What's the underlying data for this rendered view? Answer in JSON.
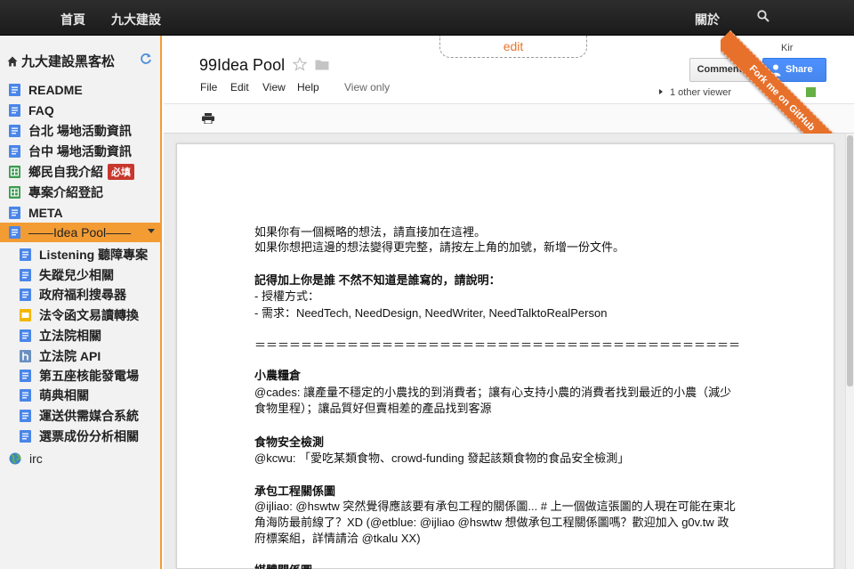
{
  "topnav": {
    "links": [
      "首頁",
      "九大建設"
    ],
    "about": "關於"
  },
  "github_ribbon": "Fork me on GitHub",
  "sidebar": {
    "title": "九大建設黑客松",
    "items": [
      {
        "label": "README",
        "icon": "doc-icon"
      },
      {
        "label": "FAQ",
        "icon": "doc-icon"
      },
      {
        "label": "台北 場地活動資訊",
        "icon": "doc-icon"
      },
      {
        "label": "台中 場地活動資訊",
        "icon": "doc-icon"
      },
      {
        "label": "鄉民自我介紹",
        "icon": "spreadsheet-icon",
        "badge": "必填"
      },
      {
        "label": "專案介紹登記",
        "icon": "spreadsheet-icon"
      },
      {
        "label": "META",
        "icon": "doc-icon"
      },
      {
        "label": "——Idea Pool——",
        "icon": "doc-icon",
        "active": true
      },
      {
        "label": "Listening 聽障專案",
        "icon": "doc-icon"
      },
      {
        "label": "失蹤兒少相關",
        "icon": "doc-icon"
      },
      {
        "label": "政府福利搜尋器",
        "icon": "doc-icon"
      },
      {
        "label": "法令函文易讀轉換",
        "icon": "slides-icon"
      },
      {
        "label": "立法院相關",
        "icon": "doc-icon"
      },
      {
        "label": "立法院 API",
        "icon": "hackpad-icon"
      },
      {
        "label": "第五座核能發電場",
        "icon": "doc-icon"
      },
      {
        "label": "萌典相關",
        "icon": "doc-icon"
      },
      {
        "label": "運送供需媒合系統",
        "icon": "doc-icon"
      },
      {
        "label": "選票成份分析相關",
        "icon": "doc-icon"
      },
      {
        "label": "irc",
        "icon": "globe-icon"
      }
    ]
  },
  "doc": {
    "edit_tab": "edit",
    "title": "99Idea Pool",
    "menus": [
      "File",
      "Edit",
      "View",
      "Help"
    ],
    "view_only": "View only",
    "user_name": "Kir",
    "comments": "Comments",
    "share": "Share",
    "viewers": "1 other viewer",
    "viewer_color": "#65b045",
    "lines": [
      {
        "text": "如果你有一個概略的想法，請直接加在這裡。"
      },
      {
        "text": "如果你想把這邊的想法變得更完整，請按左上角的加號，新增一份文件。"
      },
      {
        "text": "記得加上你是誰 不然不知道是誰寫的，請說明：",
        "bold": true
      },
      {
        "text": "- 授權方式："
      },
      {
        "text": "- 需求：NeedTech, NeedDesign, NeedWriter, NeedTalktoRealPerson"
      },
      {
        "text": "＝＝＝＝＝＝＝＝＝＝＝＝＝＝＝＝＝＝＝＝＝＝＝＝＝＝＝＝＝＝＝＝＝＝＝＝＝＝＝＝＝＝"
      },
      {
        "text": "小農糧倉",
        "bold": true
      },
      {
        "text": "@cades: 讓產量不穩定的小農找的到消費者；讓有心支持小農的消費者找到最近的小農（減少"
      },
      {
        "text": "食物里程）；讓品質好但賣相差的產品找到客源"
      },
      {
        "text": "食物安全檢測",
        "bold": true
      },
      {
        "text": "@kcwu: 「愛吃某類食物、crowd-funding 發起該類食物的食品安全檢測」"
      },
      {
        "text": "承包工程關係圖",
        "bold": true
      },
      {
        "text": "@ijliao: @hswtw 突然覺得應該要有承包工程的關係圖... # 上一個做這張圖的人現在可能在東北"
      },
      {
        "text": "角海防最前線了？XD (@etblue: @ijliao @hswtw 想做承包工程關係圖嗎？歡迎加入 g0v.tw 政"
      },
      {
        "text": "府標案組，詳情請洽 @tkalu XX)"
      },
      {
        "text": "媒體關係圖",
        "bold": true
      }
    ]
  }
}
